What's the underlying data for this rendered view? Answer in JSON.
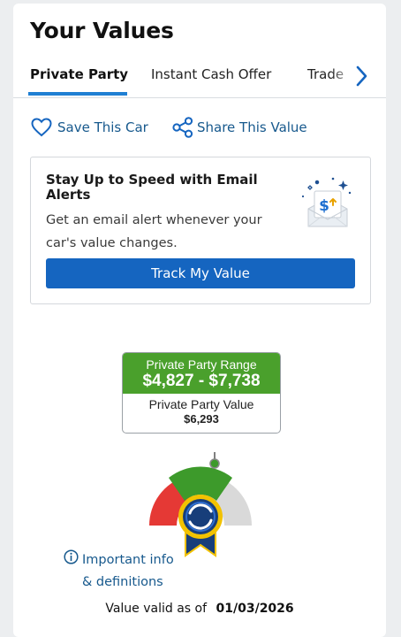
{
  "page": {
    "title": "Your Values"
  },
  "tabs": [
    {
      "label": "Private Party",
      "active": true
    },
    {
      "label": "Instant Cash Offer",
      "active": false
    },
    {
      "label": "Trade",
      "active": false
    }
  ],
  "actions": {
    "save_label": "Save This Car",
    "share_label": "Share This Value"
  },
  "alert": {
    "title": "Stay Up to Speed with Email Alerts",
    "body": "Get an email alert whenever your car's value changes.",
    "button_label": "Track My Value"
  },
  "valuation": {
    "range_label": "Private Party Range",
    "range_value": "$4,827 - $7,738",
    "value_label": "Private Party Value",
    "value": "$6,293",
    "range_low": 4827,
    "range_high": 7738,
    "value_number": 6293
  },
  "info": {
    "line1": "Important info",
    "line2": "& definitions"
  },
  "validity": {
    "prefix": "Value valid as of",
    "date": "01/03/2026"
  },
  "colors": {
    "accent_blue": "#1565c0",
    "link_blue": "#17598d",
    "tab_underline": "#1f7fd3",
    "range_green": "#4aa02c",
    "gauge_red": "#e53935",
    "gauge_gray": "#d9d9d9",
    "badge_navy": "#173e7a",
    "badge_gold": "#f2c200"
  },
  "icons": [
    "chevron-right-icon",
    "heart-icon",
    "share-icon",
    "email-money-icon",
    "value-badge-icon",
    "info-icon"
  ]
}
